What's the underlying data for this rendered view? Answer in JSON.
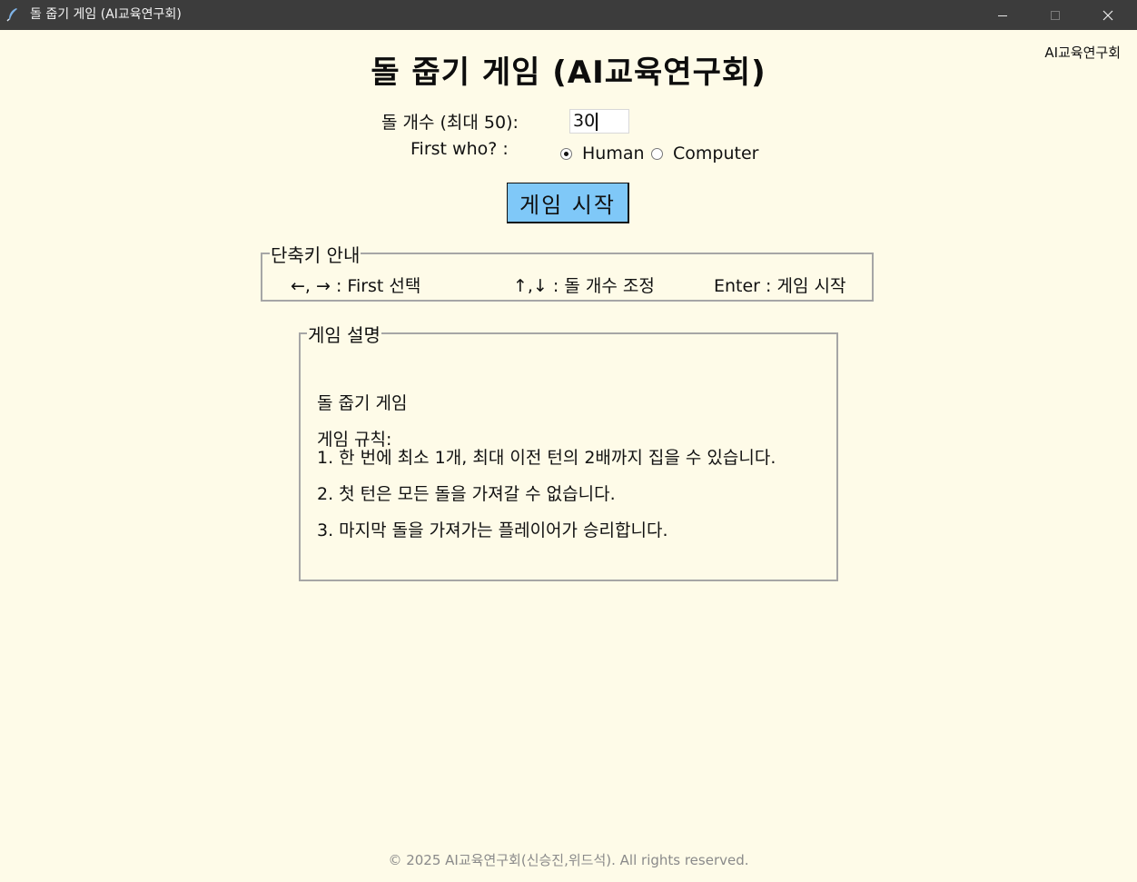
{
  "window": {
    "title": "돌 줍기 게임 (AI교육연구회)",
    "buttons": {
      "minimize": "minimize-icon",
      "maximize": "maximize-icon",
      "close": "close-icon"
    }
  },
  "header": {
    "corner_label": "AI교육연구회",
    "title": "돌 줍기 게임 (AI교육연구회)"
  },
  "setup": {
    "count_label": "돌 개수 (최대 50):",
    "count_value": "30",
    "first_label": "First who? :",
    "options": [
      {
        "label": "Human",
        "checked": true
      },
      {
        "label": "Computer",
        "checked": false
      }
    ],
    "start_button": "게임 시작"
  },
  "shortcuts": {
    "legend": "단축키 안내",
    "items": [
      "←, → : First 선택",
      "↑,↓ : 돌 개수 조정",
      "Enter : 게임 시작"
    ]
  },
  "description": {
    "legend": "게임 설명",
    "lines": [
      "돌 줍기 게임",
      "게임 규칙:",
      "1. 한 번에 최소 1개, 최대 이전 턴의 2배까지 집을 수 있습니다.",
      "2. 첫 턴은 모든 돌을 가져갈 수 없습니다.",
      "3. 마지막 돌을 가져가는 플레이어가 승리합니다."
    ]
  },
  "footer": {
    "text": "© 2025 AI교육연구회(신승진,위드석). All rights reserved."
  },
  "colors": {
    "background": "#fefbe8",
    "titlebar": "#3c3c3c",
    "start_button": "#7fc8f8",
    "box_border": "#a6a6a6",
    "footer_text": "#8a8a8a"
  }
}
